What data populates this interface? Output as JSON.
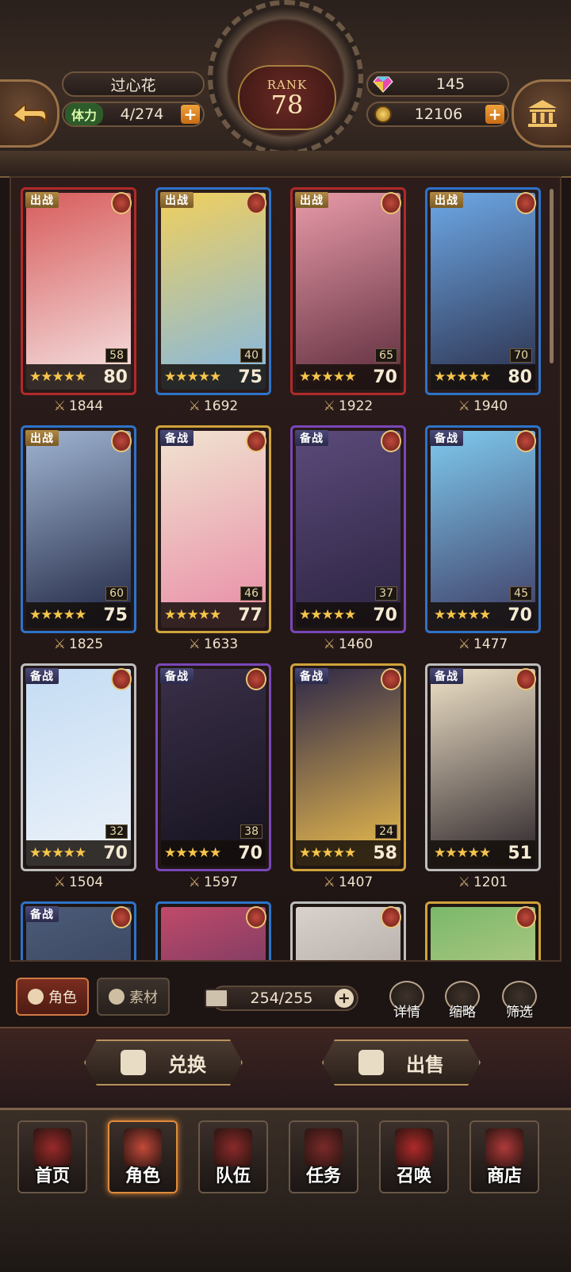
{
  "header": {
    "player_name": "过心花",
    "stamina_label": "体力",
    "stamina_value": "4/274",
    "rank_label": "RANK",
    "rank_value": "78",
    "gems": "145",
    "gold": "12106"
  },
  "cards": [
    {
      "status": "出战",
      "level": "58",
      "max_level": "80",
      "stars": 5,
      "power": "1844",
      "frame": "red",
      "art": [
        "#d85c5c",
        "#f6e7e7"
      ]
    },
    {
      "status": "出战",
      "level": "40",
      "max_level": "75",
      "stars": 5,
      "power": "1692",
      "frame": "blue",
      "art": [
        "#f1cf5d",
        "#7fb7e8"
      ]
    },
    {
      "status": "出战",
      "level": "65",
      "max_level": "70",
      "stars": 5,
      "power": "1922",
      "frame": "red",
      "art": [
        "#e89aa8",
        "#5a2a3a"
      ]
    },
    {
      "status": "出战",
      "level": "70",
      "max_level": "80",
      "stars": 5,
      "power": "1940",
      "frame": "blue",
      "art": [
        "#6da8e6",
        "#2a2d48"
      ]
    },
    {
      "status": "出战",
      "level": "60",
      "max_level": "75",
      "stars": 5,
      "power": "1825",
      "frame": "blue",
      "art": [
        "#9fb4d2",
        "#1e2440"
      ]
    },
    {
      "status": "备战",
      "level": "46",
      "max_level": "77",
      "stars": 5,
      "power": "1633",
      "frame": "gold",
      "art": [
        "#f0e3d0",
        "#e98aa6"
      ]
    },
    {
      "status": "备战",
      "level": "37",
      "max_level": "70",
      "stars": 5,
      "power": "1460",
      "frame": "purple",
      "art": [
        "#5b4a7a",
        "#2b2340"
      ]
    },
    {
      "status": "备战",
      "level": "45",
      "max_level": "70",
      "stars": 5,
      "power": "1477",
      "frame": "blue",
      "art": [
        "#7fc9ee",
        "#3d3a62"
      ]
    },
    {
      "status": "备战",
      "level": "32",
      "max_level": "70",
      "stars": 5,
      "power": "1504",
      "frame": "white",
      "art": [
        "#c4dcf3",
        "#eef3fa"
      ]
    },
    {
      "status": "备战",
      "level": "38",
      "max_level": "70",
      "stars": 5,
      "power": "1597",
      "frame": "purple",
      "art": [
        "#3a2f48",
        "#15121e"
      ]
    },
    {
      "status": "备战",
      "level": "24",
      "max_level": "58",
      "stars": 5,
      "power": "1407",
      "frame": "gold",
      "art": [
        "#2e2848",
        "#f0c04e"
      ]
    },
    {
      "status": "备战",
      "level": "",
      "max_level": "51",
      "stars": 5,
      "power": "1201",
      "frame": "white",
      "art": [
        "#efe2c8",
        "#2a2328"
      ]
    },
    {
      "status": "备战",
      "level": "",
      "max_level": "",
      "stars": 0,
      "power": "",
      "frame": "blue",
      "art": [
        "#4b5b78",
        "#2a2f44"
      ]
    },
    {
      "status": "",
      "level": "",
      "max_level": "",
      "stars": 0,
      "power": "",
      "frame": "blue",
      "art": [
        "#c04a6a",
        "#2a2a5a"
      ]
    },
    {
      "status": "",
      "level": "",
      "max_level": "",
      "stars": 0,
      "power": "",
      "frame": "white",
      "art": [
        "#d9d2cc",
        "#8a7f7a"
      ]
    },
    {
      "status": "",
      "level": "",
      "max_level": "",
      "stars": 0,
      "power": "",
      "frame": "gold",
      "art": [
        "#7ab86a",
        "#f0dca0"
      ]
    }
  ],
  "toolbar": {
    "tab_role": "角色",
    "tab_material": "素材",
    "card_count": "254/255",
    "details": "详情",
    "compact": "缩略",
    "filter": "筛选"
  },
  "actions": {
    "exchange": "兑换",
    "sell": "出售"
  },
  "nav": [
    {
      "label": "首页",
      "icon": "home-banner-icon",
      "color": "#9a2a2a"
    },
    {
      "label": "角色",
      "icon": "character-book-icon",
      "color": "#c44a3a"
    },
    {
      "label": "队伍",
      "icon": "team-emblem-icon",
      "color": "#8a2a2a"
    },
    {
      "label": "任务",
      "icon": "quest-book-icon",
      "color": "#7a2a2a"
    },
    {
      "label": "召唤",
      "icon": "summon-card-icon",
      "color": "#b02a2a"
    },
    {
      "label": "商店",
      "icon": "shop-gem-icon",
      "color": "#b03a3a"
    }
  ],
  "colors": {
    "accent": "#e08a3a",
    "star": "#f6c54a",
    "plus": "#e88a26"
  }
}
